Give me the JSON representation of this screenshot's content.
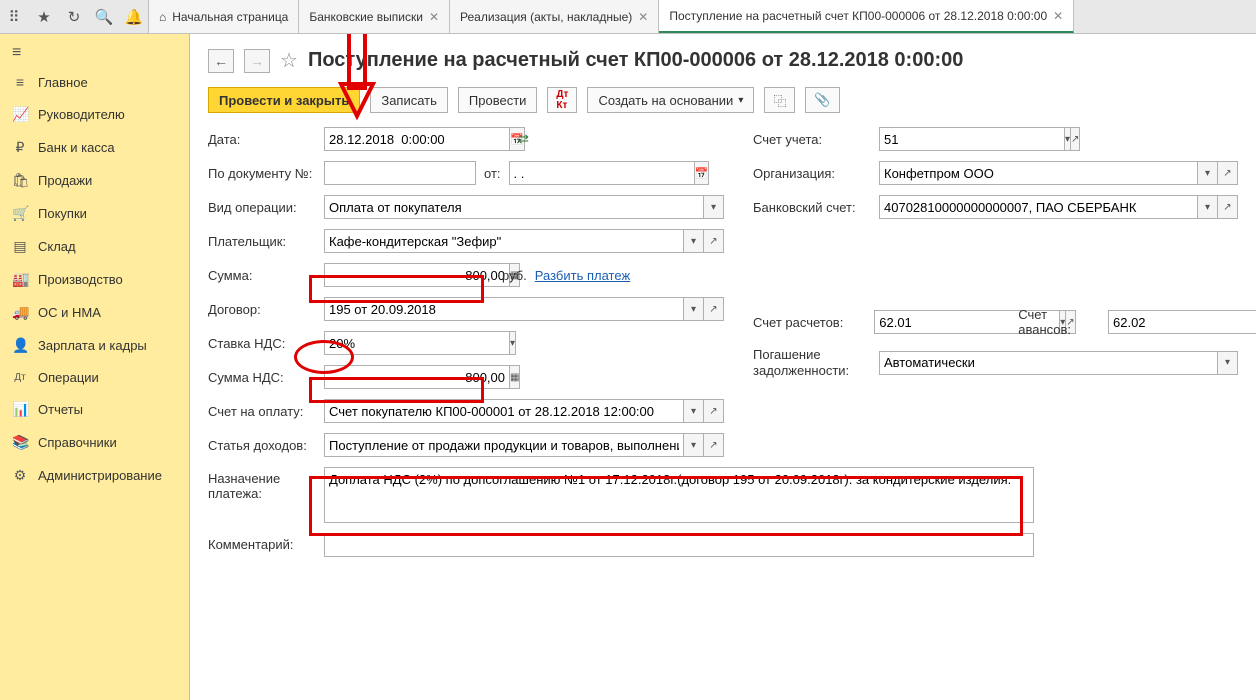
{
  "topIcons": [
    "apps",
    "star",
    "history",
    "search",
    "bell"
  ],
  "tabs": [
    {
      "label": "Начальная страница",
      "home": true
    },
    {
      "label": "Банковские выписки",
      "close": true
    },
    {
      "label": "Реализация (акты, накладные)",
      "close": true
    },
    {
      "label": "Поступление на расчетный счет КП00-000006 от 28.12.2018 0:00:00",
      "close": true,
      "active": true
    }
  ],
  "sidebar": [
    {
      "icon": "≡",
      "label": "Главное"
    },
    {
      "icon": "📈",
      "label": "Руководителю"
    },
    {
      "icon": "₽",
      "label": "Банк и касса"
    },
    {
      "icon": "🛍",
      "label": "Продажи"
    },
    {
      "icon": "🛒",
      "label": "Покупки"
    },
    {
      "icon": "▤",
      "label": "Склад"
    },
    {
      "icon": "🏭",
      "label": "Производство"
    },
    {
      "icon": "🚚",
      "label": "ОС и НМА"
    },
    {
      "icon": "👤",
      "label": "Зарплата и кадры"
    },
    {
      "icon": "Дт",
      "label": "Операции"
    },
    {
      "icon": "📊",
      "label": "Отчеты"
    },
    {
      "icon": "📚",
      "label": "Справочники"
    },
    {
      "icon": "⚙",
      "label": "Администрирование"
    }
  ],
  "pageTitle": "Поступление на расчетный счет КП00-000006 от 28.12.2018 0:00:00",
  "commands": {
    "postClose": "Провести и закрыть",
    "write": "Записать",
    "post": "Провести",
    "createBased": "Создать на основании"
  },
  "labels": {
    "date": "Дата:",
    "docNo": "По документу №:",
    "from": "от:",
    "opType": "Вид операции:",
    "payer": "Плательщик:",
    "sum": "Сумма:",
    "rub": "руб.",
    "split": "Разбить платеж",
    "contract": "Договор:",
    "vatRate": "Ставка НДС:",
    "vatSum": "Сумма НДС:",
    "invoice": "Счет на оплату:",
    "incomeItem": "Статья доходов:",
    "purpose": "Назначение платежа:",
    "comment": "Комментарий:",
    "account": "Счет учета:",
    "org": "Организация:",
    "bankAcc": "Банковский счет:",
    "settleAcc": "Счет расчетов:",
    "advanceAcc": "Счет авансов:",
    "debtRepay": "Погашение задолженности:"
  },
  "values": {
    "date": "28.12.2018  0:00:00",
    "docNo": "",
    "fromDate": ". .",
    "opType": "Оплата от покупателя",
    "payer": "Кафе-кондитерская \"Зефир\"",
    "sum": "800,00",
    "contract": "195 от 20.09.2018",
    "vatRate": "20%",
    "vatSum": "800,00",
    "invoice": "Счет покупателю КП00-000001 от 28.12.2018 12:00:00",
    "incomeItem": "Поступление от продажи продукции и товаров, выполнения",
    "purpose": "Доплата НДС (2%) по допсоглашению №1 от 17.12.2018г.(договор 195 от 20.09.2018г). за кондитерские изделия.",
    "comment": "",
    "account": "51",
    "org": "Конфетпром ООО",
    "bankAcc": "40702810000000000007, ПАО СБЕРБАНК",
    "settleAcc": "62.01",
    "advanceAcc": "62.02",
    "debtRepay": "Автоматически"
  }
}
